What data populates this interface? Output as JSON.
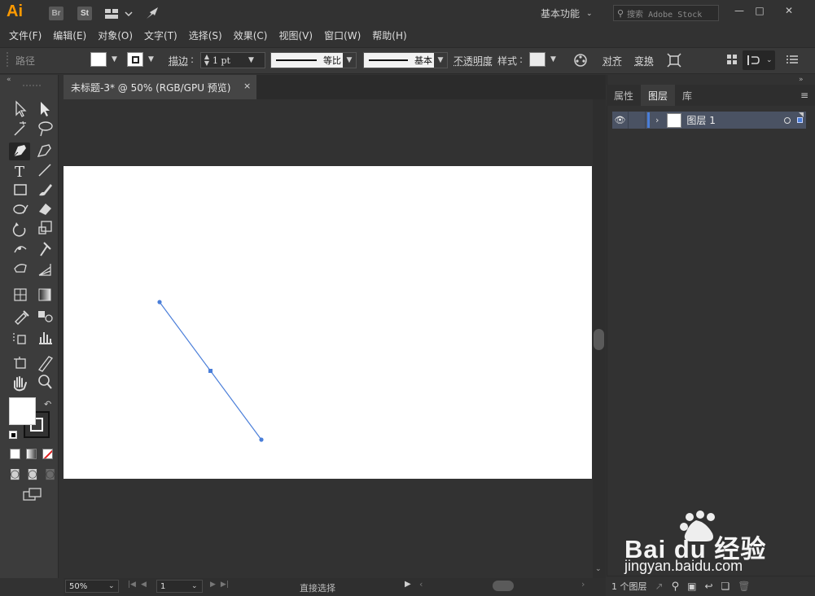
{
  "app": {
    "logo": "Ai",
    "bridge_badge": "Br",
    "stock_badge": "St",
    "workspace": "基本功能",
    "search_placeholder": "搜索 Adobe Stock"
  },
  "menu": [
    "文件(F)",
    "编辑(E)",
    "对象(O)",
    "文字(T)",
    "选择(S)",
    "效果(C)",
    "视图(V)",
    "窗口(W)",
    "帮助(H)"
  ],
  "control_bar": {
    "selection_label": "路径",
    "stroke_label": "描边",
    "stroke_weight": "1 pt",
    "variable_width_profile": "等比",
    "brush_definition": "基本",
    "opacity_label": "不透明度",
    "style_label": "样式",
    "align_label": "对齐",
    "transform_label": "变换"
  },
  "document_tab": {
    "title": "未标题-3* @ 50% (RGB/GPU 预览)",
    "close": "×"
  },
  "status_bar": {
    "zoom": "50%",
    "artboard_number": "1",
    "tool_status": "直接选择"
  },
  "panel": {
    "tabs": [
      "属性",
      "图层",
      "库"
    ],
    "active_tab": "图层",
    "layer_name": "图层 1",
    "layer_count": "1 个图层",
    "layer_color": "#4a7ed9"
  },
  "watermark": {
    "brand": "Bai du 经验",
    "url": "jingyan.baidu.com"
  },
  "colors": {
    "accent": "#ff9a00",
    "path_stroke": "#4a7ed9",
    "artboard": "#ffffff"
  }
}
